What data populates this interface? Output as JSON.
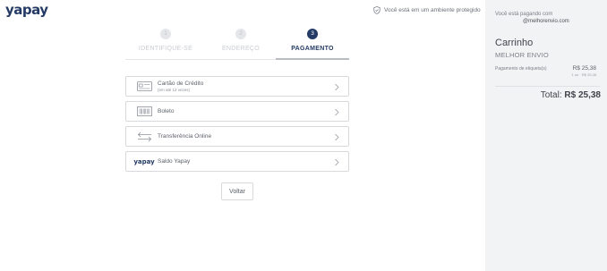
{
  "header": {
    "logo": "yapay",
    "secure_text": "Você está em um ambiente protegido"
  },
  "steps": [
    {
      "number": "1",
      "label": "IDENTIFIQUE-SE",
      "state": "done"
    },
    {
      "number": "2",
      "label": "ENDEREÇO",
      "state": "done"
    },
    {
      "number": "3",
      "label": "PAGAMENTO",
      "state": "active"
    }
  ],
  "payment_options": [
    {
      "label": "Cartão de Crédito",
      "sub": "(em até 12 vezes)",
      "icon": "credit-card-icon"
    },
    {
      "label": "Boleto",
      "sub": "",
      "icon": "barcode-icon"
    },
    {
      "label": "Transferência Online",
      "sub": "",
      "icon": "transfer-arrows-icon"
    },
    {
      "label": "Saldo Yapay",
      "sub": "",
      "icon": "yapay-logo-icon",
      "icon_text": "yapay"
    }
  ],
  "back_label": "Voltar",
  "summary": {
    "paying_to_label": "Você está pagando com",
    "email": "@melhorenvio.com",
    "cart_title": "Carrinho",
    "store": "MELHOR ENVIO",
    "item_label": "Pagamento de etiqueta(s)",
    "item_price": "R$ 25,38",
    "item_qty": "1 un · R$ 25,38",
    "total_label": "Total:",
    "total_value": "R$ 25,38"
  },
  "colors": {
    "brand": "#243b65",
    "sidebar_bg": "#f2f3f4",
    "border": "#d7d9dc"
  }
}
